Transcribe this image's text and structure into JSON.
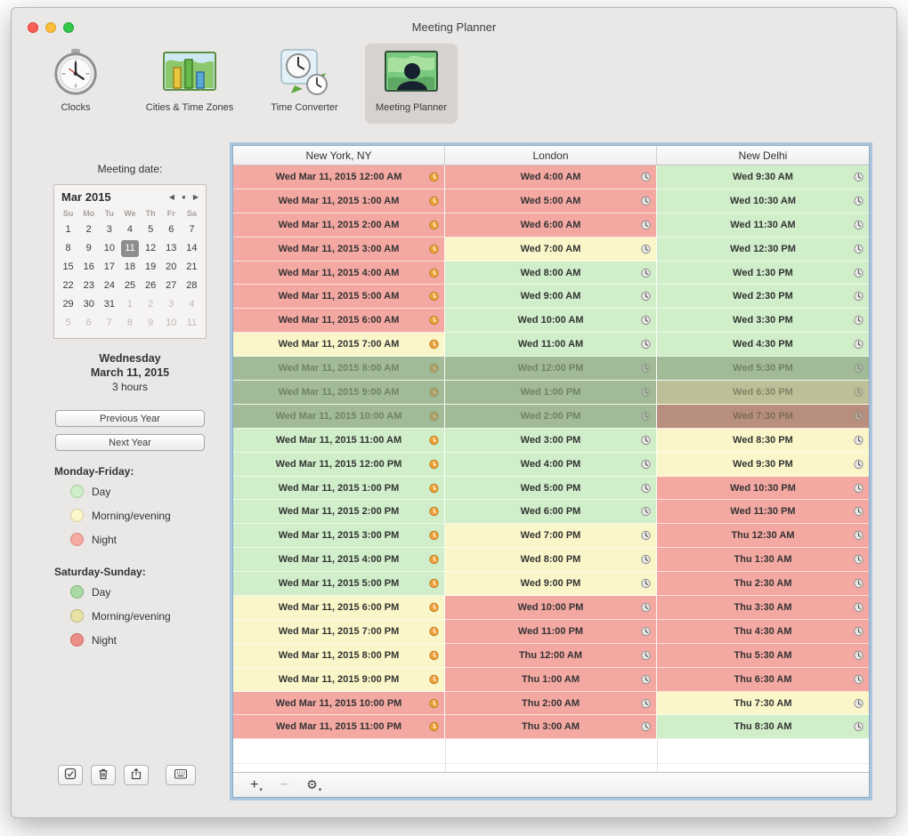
{
  "window": {
    "title": "Meeting Planner"
  },
  "toolbar": {
    "selected_index": 3,
    "items": [
      {
        "label": "Clocks"
      },
      {
        "label": "Cities & Time Zones"
      },
      {
        "label": "Time Converter"
      },
      {
        "label": "Meeting Planner"
      }
    ]
  },
  "sidebar": {
    "meeting_date_label": "Meeting date:",
    "calendar": {
      "title": "Mar 2015",
      "nav_prev": "◀",
      "nav_today": "●",
      "nav_next": "▶",
      "day_headers": [
        "Su",
        "Mo",
        "Tu",
        "We",
        "Th",
        "Fr",
        "Sa"
      ],
      "days": [
        {
          "d": "1"
        },
        {
          "d": "2"
        },
        {
          "d": "3"
        },
        {
          "d": "4"
        },
        {
          "d": "5"
        },
        {
          "d": "6"
        },
        {
          "d": "7"
        },
        {
          "d": "8"
        },
        {
          "d": "9"
        },
        {
          "d": "10"
        },
        {
          "d": "11",
          "state": "sel"
        },
        {
          "d": "12"
        },
        {
          "d": "13"
        },
        {
          "d": "14"
        },
        {
          "d": "15"
        },
        {
          "d": "16"
        },
        {
          "d": "17"
        },
        {
          "d": "18"
        },
        {
          "d": "19"
        },
        {
          "d": "20"
        },
        {
          "d": "21"
        },
        {
          "d": "22"
        },
        {
          "d": "23"
        },
        {
          "d": "24"
        },
        {
          "d": "25"
        },
        {
          "d": "26"
        },
        {
          "d": "27"
        },
        {
          "d": "28"
        },
        {
          "d": "29"
        },
        {
          "d": "30"
        },
        {
          "d": "31"
        },
        {
          "d": "1",
          "state": "dim"
        },
        {
          "d": "2",
          "state": "dim"
        },
        {
          "d": "3",
          "state": "dim"
        },
        {
          "d": "4",
          "state": "dim"
        },
        {
          "d": "5",
          "state": "dim"
        },
        {
          "d": "6",
          "state": "dim"
        },
        {
          "d": "7",
          "state": "dim"
        },
        {
          "d": "8",
          "state": "dim"
        },
        {
          "d": "9",
          "state": "dim"
        },
        {
          "d": "10",
          "state": "dim"
        },
        {
          "d": "11",
          "state": "dim"
        }
      ]
    },
    "selection_summary": {
      "weekday": "Wednesday",
      "date": "March 11, 2015",
      "duration": "3 hours"
    },
    "previous_year_label": "Previous Year",
    "next_year_label": "Next Year",
    "legend": [
      {
        "title": "Monday-Friday:",
        "items": [
          {
            "label": "Day",
            "color": "#cfeec9",
            "border": "#a3cd9b"
          },
          {
            "label": "Morning/evening",
            "color": "#fbf7cb",
            "border": "#d8d09a"
          },
          {
            "label": "Night",
            "color": "#f6aba4",
            "border": "#d98880"
          }
        ]
      },
      {
        "title": "Saturday-Sunday:",
        "items": [
          {
            "label": "Day",
            "color": "#a9d9a4",
            "border": "#7fb37a"
          },
          {
            "label": "Morning/evening",
            "color": "#e7e2a6",
            "border": "#bdb677"
          },
          {
            "label": "Night",
            "color": "#ec8f87",
            "border": "#c9675f"
          }
        ]
      }
    ]
  },
  "table": {
    "columns": [
      "New York, NY",
      "London",
      "New Delhi"
    ],
    "tone_colors": {
      "day": "#cfeec9",
      "morning": "#faf6c9",
      "night": "#f4a8a2"
    },
    "rows": [
      {
        "selected": false,
        "cells": [
          {
            "text": "Wed Mar 11, 2015 12:00 AM",
            "tone": "night"
          },
          {
            "text": "Wed 4:00 AM",
            "tone": "night"
          },
          {
            "text": "Wed 9:30 AM",
            "tone": "day"
          }
        ]
      },
      {
        "selected": false,
        "cells": [
          {
            "text": "Wed Mar 11, 2015 1:00 AM",
            "tone": "night"
          },
          {
            "text": "Wed 5:00 AM",
            "tone": "night"
          },
          {
            "text": "Wed 10:30 AM",
            "tone": "day"
          }
        ]
      },
      {
        "selected": false,
        "cells": [
          {
            "text": "Wed Mar 11, 2015 2:00 AM",
            "tone": "night"
          },
          {
            "text": "Wed 6:00 AM",
            "tone": "night"
          },
          {
            "text": "Wed 11:30 AM",
            "tone": "day"
          }
        ]
      },
      {
        "selected": false,
        "cells": [
          {
            "text": "Wed Mar 11, 2015 3:00 AM",
            "tone": "night"
          },
          {
            "text": "Wed 7:00 AM",
            "tone": "morning"
          },
          {
            "text": "Wed 12:30 PM",
            "tone": "day"
          }
        ]
      },
      {
        "selected": false,
        "cells": [
          {
            "text": "Wed Mar 11, 2015 4:00 AM",
            "tone": "night"
          },
          {
            "text": "Wed 8:00 AM",
            "tone": "day"
          },
          {
            "text": "Wed 1:30 PM",
            "tone": "day"
          }
        ]
      },
      {
        "selected": false,
        "cells": [
          {
            "text": "Wed Mar 11, 2015 5:00 AM",
            "tone": "night"
          },
          {
            "text": "Wed 9:00 AM",
            "tone": "day"
          },
          {
            "text": "Wed 2:30 PM",
            "tone": "day"
          }
        ]
      },
      {
        "selected": false,
        "cells": [
          {
            "text": "Wed Mar 11, 2015 6:00 AM",
            "tone": "night"
          },
          {
            "text": "Wed 10:00 AM",
            "tone": "day"
          },
          {
            "text": "Wed 3:30 PM",
            "tone": "day"
          }
        ]
      },
      {
        "selected": false,
        "cells": [
          {
            "text": "Wed Mar 11, 2015 7:00 AM",
            "tone": "morning"
          },
          {
            "text": "Wed 11:00 AM",
            "tone": "day"
          },
          {
            "text": "Wed 4:30 PM",
            "tone": "day"
          }
        ]
      },
      {
        "selected": true,
        "cells": [
          {
            "text": "Wed Mar 11, 2015 8:00 AM",
            "tone": "day"
          },
          {
            "text": "Wed 12:00 PM",
            "tone": "day"
          },
          {
            "text": "Wed 5:30 PM",
            "tone": "day"
          }
        ]
      },
      {
        "selected": true,
        "cells": [
          {
            "text": "Wed Mar 11, 2015 9:00 AM",
            "tone": "day"
          },
          {
            "text": "Wed 1:00 PM",
            "tone": "day"
          },
          {
            "text": "Wed 6:30 PM",
            "tone": "morning"
          }
        ]
      },
      {
        "selected": true,
        "cells": [
          {
            "text": "Wed Mar 11, 2015 10:00 AM",
            "tone": "day"
          },
          {
            "text": "Wed 2:00 PM",
            "tone": "day"
          },
          {
            "text": "Wed 7:30 PM",
            "tone": "night"
          }
        ]
      },
      {
        "selected": false,
        "cells": [
          {
            "text": "Wed Mar 11, 2015 11:00 AM",
            "tone": "day"
          },
          {
            "text": "Wed 3:00 PM",
            "tone": "day"
          },
          {
            "text": "Wed 8:30 PM",
            "tone": "morning"
          }
        ]
      },
      {
        "selected": false,
        "cells": [
          {
            "text": "Wed Mar 11, 2015 12:00 PM",
            "tone": "day"
          },
          {
            "text": "Wed 4:00 PM",
            "tone": "day"
          },
          {
            "text": "Wed 9:30 PM",
            "tone": "morning"
          }
        ]
      },
      {
        "selected": false,
        "cells": [
          {
            "text": "Wed Mar 11, 2015 1:00 PM",
            "tone": "day"
          },
          {
            "text": "Wed 5:00 PM",
            "tone": "day"
          },
          {
            "text": "Wed 10:30 PM",
            "tone": "night"
          }
        ]
      },
      {
        "selected": false,
        "cells": [
          {
            "text": "Wed Mar 11, 2015 2:00 PM",
            "tone": "day"
          },
          {
            "text": "Wed 6:00 PM",
            "tone": "day"
          },
          {
            "text": "Wed 11:30 PM",
            "tone": "night"
          }
        ]
      },
      {
        "selected": false,
        "cells": [
          {
            "text": "Wed Mar 11, 2015 3:00 PM",
            "tone": "day"
          },
          {
            "text": "Wed 7:00 PM",
            "tone": "morning"
          },
          {
            "text": "Thu 12:30 AM",
            "tone": "night"
          }
        ]
      },
      {
        "selected": false,
        "cells": [
          {
            "text": "Wed Mar 11, 2015 4:00 PM",
            "tone": "day"
          },
          {
            "text": "Wed 8:00 PM",
            "tone": "morning"
          },
          {
            "text": "Thu 1:30 AM",
            "tone": "night"
          }
        ]
      },
      {
        "selected": false,
        "cells": [
          {
            "text": "Wed Mar 11, 2015 5:00 PM",
            "tone": "day"
          },
          {
            "text": "Wed 9:00 PM",
            "tone": "morning"
          },
          {
            "text": "Thu 2:30 AM",
            "tone": "night"
          }
        ]
      },
      {
        "selected": false,
        "cells": [
          {
            "text": "Wed Mar 11, 2015 6:00 PM",
            "tone": "morning"
          },
          {
            "text": "Wed 10:00 PM",
            "tone": "night"
          },
          {
            "text": "Thu 3:30 AM",
            "tone": "night"
          }
        ]
      },
      {
        "selected": false,
        "cells": [
          {
            "text": "Wed Mar 11, 2015 7:00 PM",
            "tone": "morning"
          },
          {
            "text": "Wed 11:00 PM",
            "tone": "night"
          },
          {
            "text": "Thu 4:30 AM",
            "tone": "night"
          }
        ]
      },
      {
        "selected": false,
        "cells": [
          {
            "text": "Wed Mar 11, 2015 8:00 PM",
            "tone": "morning"
          },
          {
            "text": "Thu 12:00 AM",
            "tone": "night"
          },
          {
            "text": "Thu 5:30 AM",
            "tone": "night"
          }
        ]
      },
      {
        "selected": false,
        "cells": [
          {
            "text": "Wed Mar 11, 2015 9:00 PM",
            "tone": "morning"
          },
          {
            "text": "Thu 1:00 AM",
            "tone": "night"
          },
          {
            "text": "Thu 6:30 AM",
            "tone": "night"
          }
        ]
      },
      {
        "selected": false,
        "cells": [
          {
            "text": "Wed Mar 11, 2015 10:00 PM",
            "tone": "night"
          },
          {
            "text": "Thu 2:00 AM",
            "tone": "night"
          },
          {
            "text": "Thu 7:30 AM",
            "tone": "morning"
          }
        ]
      },
      {
        "selected": false,
        "cells": [
          {
            "text": "Wed Mar 11, 2015 11:00 PM",
            "tone": "night"
          },
          {
            "text": "Thu 3:00 AM",
            "tone": "night"
          },
          {
            "text": "Thu 8:30 AM",
            "tone": "day"
          }
        ]
      }
    ]
  },
  "table_footer": {
    "add_label": "+",
    "remove_label": "−",
    "gear_icon": "⚙",
    "dropdown_arrow": "▾"
  }
}
